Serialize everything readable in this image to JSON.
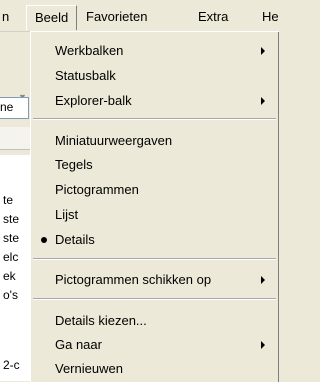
{
  "menubar": {
    "partial_left": "n",
    "items": [
      "Beeld",
      "Favorieten",
      "Extra",
      "He"
    ]
  },
  "background": {
    "address_fragment": "ne",
    "list_fragments": [
      "te",
      "ste",
      "ste",
      "elc",
      "ek",
      "o's",
      "2-c"
    ]
  },
  "menu": {
    "items": [
      {
        "label": "Werkbalken",
        "submenu": true
      },
      {
        "label": "Statusbalk"
      },
      {
        "label": "Explorer-balk",
        "submenu": true
      },
      {
        "label": "Miniatuurweergaven"
      },
      {
        "label": "Tegels"
      },
      {
        "label": "Pictogrammen"
      },
      {
        "label": "Lijst"
      },
      {
        "label": "Details",
        "selected": true
      },
      {
        "label": "Pictogrammen schikken op",
        "submenu": true
      },
      {
        "label": "Details kiezen..."
      },
      {
        "label": "Ga naar",
        "submenu": true
      },
      {
        "label": "Vernieuwen"
      }
    ]
  }
}
